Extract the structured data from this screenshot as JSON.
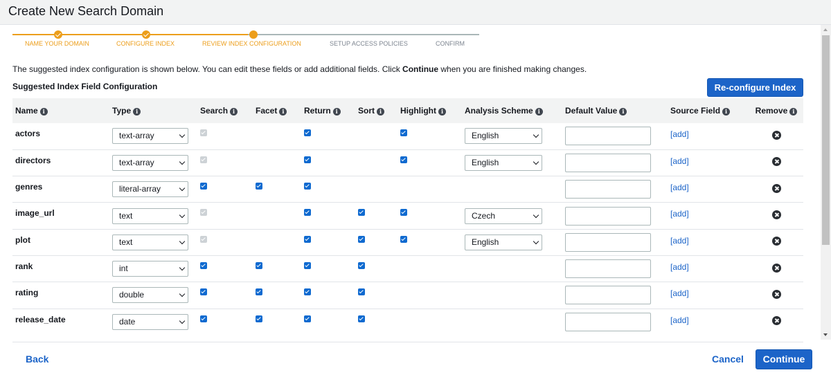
{
  "header": {
    "title": "Create New Search Domain"
  },
  "stepper": {
    "steps": [
      {
        "label": "NAME YOUR DOMAIN",
        "state": "done"
      },
      {
        "label": "CONFIGURE INDEX",
        "state": "done"
      },
      {
        "label": "REVIEW INDEX CONFIGURATION",
        "state": "current"
      },
      {
        "label": "SETUP ACCESS POLICIES",
        "state": "pending"
      },
      {
        "label": "CONFIRM",
        "state": "pending"
      }
    ],
    "colors": {
      "active": "#ec9e1b",
      "pending": "#7d8590"
    }
  },
  "intro": {
    "before": "The suggested index configuration is shown below. You can edit these fields or add additional fields. Click ",
    "bold": "Continue",
    "after": " when you are finished making changes."
  },
  "section_title": "Suggested Index Field Configuration",
  "reconfigure_button": "Re-configure Index",
  "table": {
    "columns": [
      "Name",
      "Type",
      "Search",
      "Facet",
      "Return",
      "Sort",
      "Highlight",
      "Analysis Scheme",
      "Default Value",
      "Source Field",
      "Remove"
    ],
    "add_label": "[add]",
    "rows": [
      {
        "name": "actors",
        "type": "text-array",
        "search": "disabled",
        "facet": "none",
        "return": "checked",
        "sort": "none",
        "highlight": "checked",
        "analysis": "English"
      },
      {
        "name": "directors",
        "type": "text-array",
        "search": "disabled",
        "facet": "none",
        "return": "checked",
        "sort": "none",
        "highlight": "checked",
        "analysis": "English"
      },
      {
        "name": "genres",
        "type": "literal-array",
        "search": "checked",
        "facet": "checked",
        "return": "checked",
        "sort": "none",
        "highlight": "none",
        "analysis": ""
      },
      {
        "name": "image_url",
        "type": "text",
        "search": "disabled",
        "facet": "none",
        "return": "checked",
        "sort": "checked",
        "highlight": "checked",
        "analysis": "Czech"
      },
      {
        "name": "plot",
        "type": "text",
        "search": "disabled",
        "facet": "none",
        "return": "checked",
        "sort": "checked",
        "highlight": "checked",
        "analysis": "English"
      },
      {
        "name": "rank",
        "type": "int",
        "search": "checked",
        "facet": "checked",
        "return": "checked",
        "sort": "checked",
        "highlight": "none",
        "analysis": ""
      },
      {
        "name": "rating",
        "type": "double",
        "search": "checked",
        "facet": "checked",
        "return": "checked",
        "sort": "checked",
        "highlight": "none",
        "analysis": ""
      },
      {
        "name": "release_date",
        "type": "date",
        "search": "checked",
        "facet": "checked",
        "return": "checked",
        "sort": "checked",
        "highlight": "none",
        "analysis": ""
      }
    ]
  },
  "footer": {
    "back": "Back",
    "cancel": "Cancel",
    "continue": "Continue"
  },
  "colors": {
    "primary": "#1c64c8",
    "checkbox": "#0f6ad0",
    "header_bg": "#f2f3f3"
  }
}
